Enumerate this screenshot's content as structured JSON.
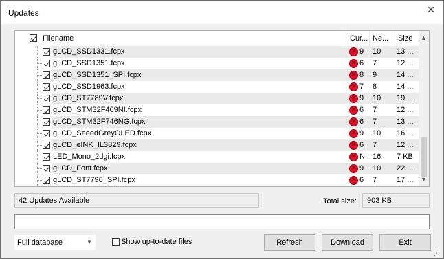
{
  "window": {
    "title": "Updates",
    "close_glyph": "✕"
  },
  "list": {
    "headers": {
      "name": "Filename",
      "current": "Cur...",
      "new": "Ne...",
      "size": "Size"
    },
    "rows": [
      {
        "name": "gLCD_SSD1331.fcpx",
        "current": "9",
        "new": "10",
        "size": "13 ..."
      },
      {
        "name": "gLCD_SSD1351.fcpx",
        "current": "6",
        "new": "7",
        "size": "12 ..."
      },
      {
        "name": "gLCD_SSD1351_SPI.fcpx",
        "current": "8",
        "new": "9",
        "size": "14 ..."
      },
      {
        "name": "gLCD_SSD1963.fcpx",
        "current": "7",
        "new": "8",
        "size": "14 ..."
      },
      {
        "name": "gLCD_ST7789V.fcpx",
        "current": "9",
        "new": "10",
        "size": "19 ..."
      },
      {
        "name": "gLCD_STM32F469NI.fcpx",
        "current": "6",
        "new": "7",
        "size": "12 ..."
      },
      {
        "name": "gLCD_STM32F746NG.fcpx",
        "current": "6",
        "new": "7",
        "size": "13 ..."
      },
      {
        "name": "gLCD_SeeedGreyOLED.fcpx",
        "current": "9",
        "new": "10",
        "size": "16 ..."
      },
      {
        "name": "gLCD_eINK_IL3829.fcpx",
        "current": "6",
        "new": "7",
        "size": "12 ..."
      },
      {
        "name": "LED_Mono_2dgi.fcpx",
        "current": "N.",
        "new": "16",
        "size": "7 KB"
      },
      {
        "name": "gLCD_Font.fcpx",
        "current": "9",
        "new": "10",
        "size": "22 ..."
      },
      {
        "name": "gLCD_ST7796_SPI.fcpx",
        "current": "6",
        "new": "7",
        "size": "17 ..."
      }
    ]
  },
  "status": {
    "available": "42 Updates Available",
    "total_label": "Total size:",
    "total_value": "903 KB"
  },
  "footer": {
    "database_select": "Full database",
    "show_uptodate_label": "Show up-to-date files",
    "refresh_label": "Refresh",
    "download_label": "Download",
    "exit_label": "Exit"
  },
  "icons": {
    "scroll_up": "▲",
    "scroll_down": "▼",
    "select_arrow": "▼",
    "grip": "⋰"
  },
  "colors": {
    "status_dot": "#e0102a",
    "shaded_row": "#eaeaea"
  }
}
